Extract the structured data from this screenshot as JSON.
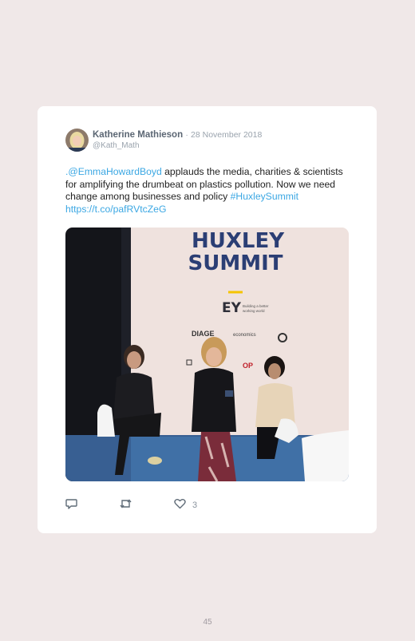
{
  "tweet": {
    "author_name": "Katherine Mathieson",
    "separator": "·",
    "date": "28 November 2018",
    "handle": "@Kath_Math",
    "text_prefix": ".",
    "mention": "@EmmaHowardBoyd",
    "text_body": " applauds the media, charities & scientists for amplifying the drumbeat on plastics pollution. Now we need change among businesses and policy ",
    "hashtag": "#HuxleySummit",
    "url": "https://t.co/pafRVtcZeG",
    "photo": {
      "banner_line1": "HUXLEY",
      "banner_line2": "SUMMIT",
      "sponsor1_logo": "EY",
      "sponsor1_tagline_1": "Building a better",
      "sponsor1_tagline_2": "working world",
      "sponsor2_logo": "DIAGE",
      "sponsor3": "economics",
      "sponsor4": "OP"
    },
    "actions": {
      "reply_icon": "reply-icon",
      "retweet_icon": "retweet-icon",
      "like_icon": "heart-icon",
      "like_count": "3"
    }
  },
  "page": {
    "number": "45"
  },
  "colors": {
    "background": "#f0e8e8",
    "link": "#3ba7e3",
    "card": "#ffffff"
  }
}
